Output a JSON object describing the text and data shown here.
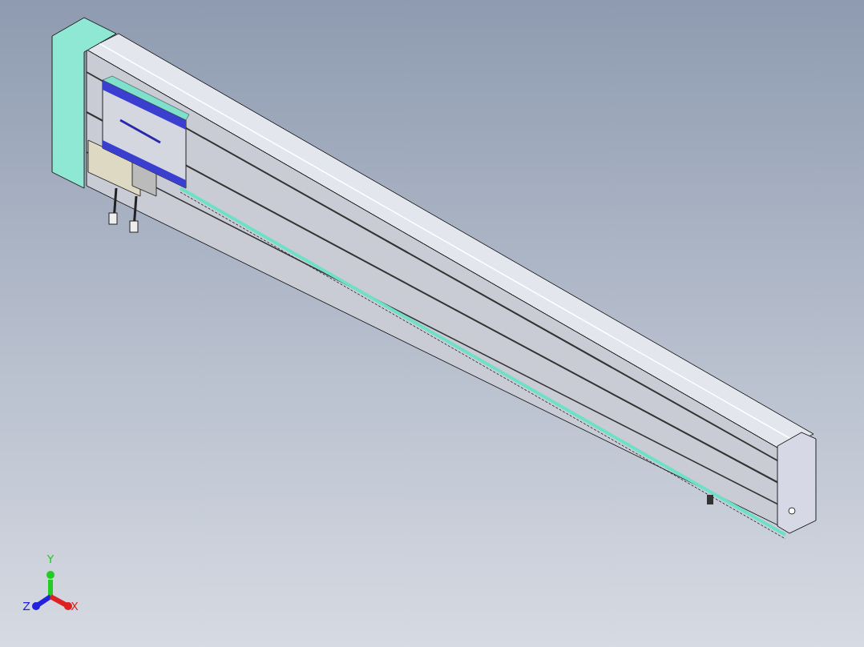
{
  "viewport": {
    "triad": {
      "axes": [
        {
          "label": "Y",
          "color": "#22cc22"
        },
        {
          "label": "Z",
          "color": "#2222dd"
        },
        {
          "label": "X",
          "color": "#dd2222"
        }
      ]
    }
  }
}
